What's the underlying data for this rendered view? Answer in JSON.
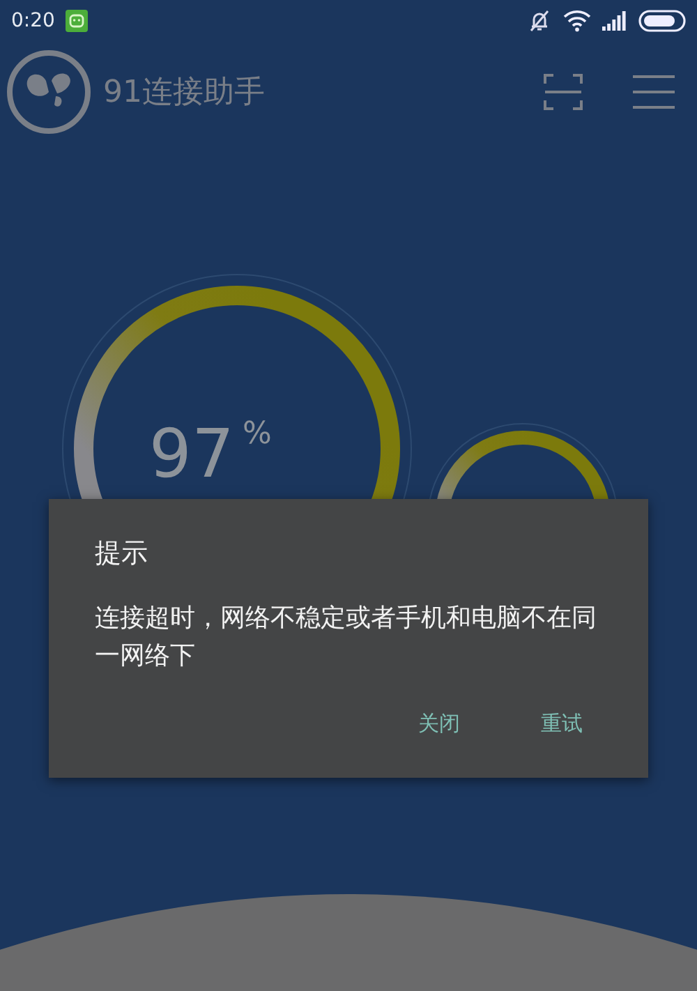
{
  "status_bar": {
    "time": "0:20"
  },
  "app_bar": {
    "title": "91连接助手"
  },
  "gauges": [
    {
      "kind": "main",
      "value": "97",
      "unit": "%"
    },
    {
      "kind": "secondary"
    }
  ],
  "dialog": {
    "title": "提示",
    "message": "连接超时，网络不稳定或者手机和电脑不在同一网络下",
    "buttons": [
      "关闭",
      "重试"
    ]
  }
}
